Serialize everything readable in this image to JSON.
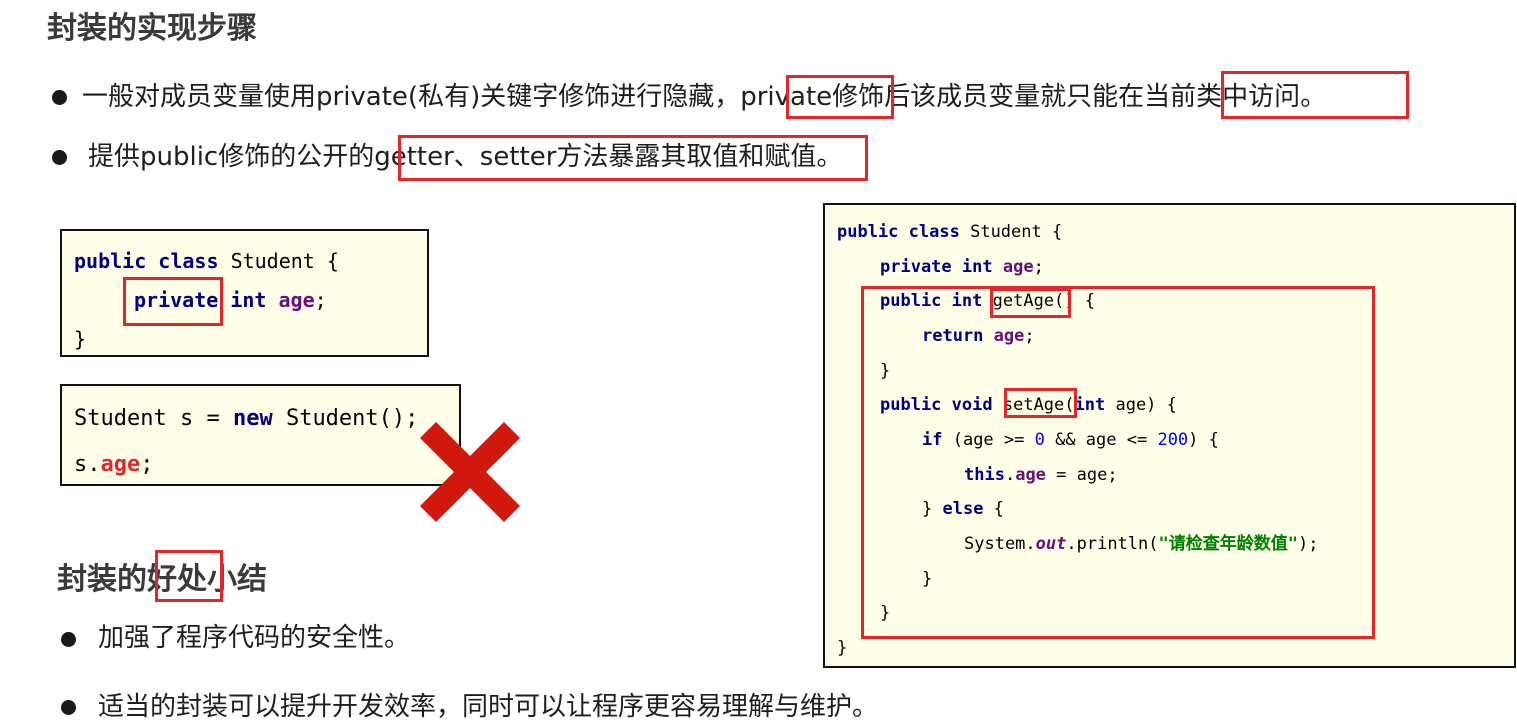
{
  "impl": {
    "heading": "封装的实现步骤",
    "bullet1_a": "一般对成员变量使用private(私有)关键字修饰进行隐藏，",
    "bullet1_b": "private",
    "bullet1_c": "修饰后该成员变量就只能在",
    "bullet1_d": "当前类中访问",
    "bullet1_e": "。",
    "bullet2_a": "提供public修饰的公开的",
    "bullet2_b": "getter、setter方法暴露其取值和赋值",
    "bullet2_c": "。"
  },
  "code1": {
    "kw_public": "public",
    "kw_class": "class",
    "classname": "Student {",
    "kw_private": "private",
    "kw_int": "int",
    "field": "age",
    "semicolon": ";",
    "close": "}"
  },
  "code2": {
    "line1_a": "Student s = ",
    "kw_new": "new",
    "line1_b": " Student();",
    "line2_a": "s.",
    "field": "age",
    "line2_b": ";"
  },
  "code3": {
    "l1_kw1": "public",
    "l1_kw2": "class",
    "l1_rest": " Student {",
    "l2_kw1": "private",
    "l2_kw2": "int",
    "l2_fld": "age",
    "l2_rest": ";",
    "l3_kw1": "public",
    "l3_kw2": "int",
    "l3_rest": " getAge() {",
    "l4_kw": "return",
    "l4_fld": "age",
    "l4_rest": ";",
    "l5": "}",
    "l6_kw1": "public",
    "l6_kw2": "void",
    "l6_a": " setAge(",
    "l6_kw3": "int",
    "l6_b": " age) {",
    "l7_kw": "if",
    "l7_a": " (age >= ",
    "l7_n1": "0",
    "l7_b": " && age <= ",
    "l7_n2": "200",
    "l7_c": ") {",
    "l8_kw": "this",
    "l8_dot": ".",
    "l8_fld": "age",
    "l8_rest": " = age;",
    "l9_a": "} ",
    "l9_kw": "else",
    "l9_b": " {",
    "l10_a": "System.",
    "l10_out": "out",
    "l10_b": ".println(",
    "l10_str": "\"请检查年龄数值\"",
    "l10_c": ");",
    "l11": "}",
    "l12": "}",
    "l13": "}"
  },
  "benefits": {
    "heading_a": "封装的",
    "heading_b": "好处",
    "heading_c": "小结",
    "bullet1": "加强了程序代码的安全性。",
    "bullet2": "适当的封装可以提升开发效率，同时可以让程序更容易理解与维护。"
  },
  "colors": {
    "highlight_box": "#e0272b",
    "code_bg": "#fefde8",
    "keyword": "#000080",
    "field": "#660e7a",
    "number": "#0000ff",
    "string": "#008000",
    "cross": "#d0180f"
  },
  "icons": {
    "cross": "red-x-cross-icon"
  }
}
